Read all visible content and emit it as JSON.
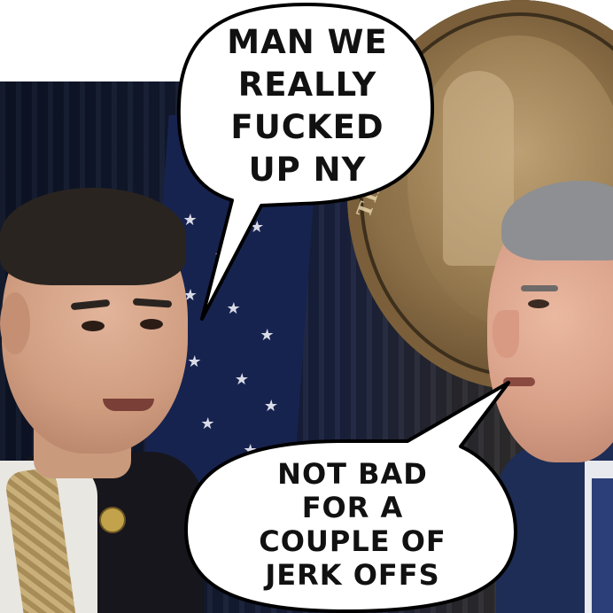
{
  "meme": {
    "top_bubble": {
      "lines": [
        "MAN WE",
        "REALLY",
        "FUCKED",
        "UP NY"
      ]
    },
    "bottom_bubble": {
      "lines": [
        "NOT BAD",
        "FOR A",
        "COUPLE OF",
        "JERK OFFS"
      ]
    },
    "seal_text": "THE GREA"
  }
}
